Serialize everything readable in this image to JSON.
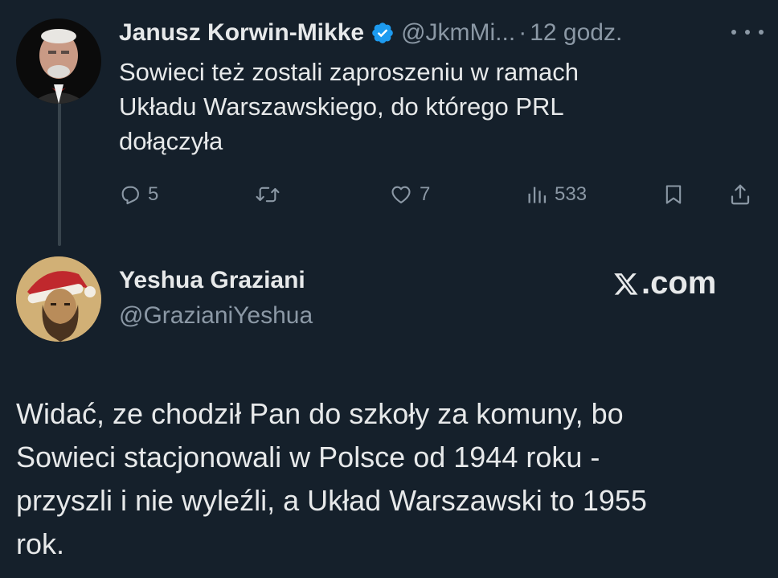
{
  "tweet1": {
    "author_name": "Janusz Korwin-Mikke",
    "handle": "@JkmMi...",
    "separator": "·",
    "time": "12 godz.",
    "text": "Sowieci też zostali zaproszeniu w ramach\nUkładu Warszawskiego, do którego PRL\ndołączyła",
    "actions": {
      "replies": "5",
      "reposts": "",
      "likes": "7",
      "views": "533"
    },
    "icons": [
      "verified-badge-icon",
      "more-icon",
      "reply-icon",
      "retweet-icon",
      "like-icon",
      "views-icon",
      "bookmark-icon",
      "share-icon"
    ]
  },
  "tweet2": {
    "author_name": "Yeshua Graziani",
    "handle": "@GrazianiYeshua",
    "text": "Widać, ze chodził Pan do szkoły za komuny, bo\nSowieci stacjonowali w Polsce od 1944 roku -\nprzyszli i nie wyleźli, a Układ Warszawski to 1955\nrok."
  },
  "watermark": {
    "text": ".com"
  },
  "colors": {
    "background": "#15202b",
    "text_primary": "#e7e9ea",
    "text_secondary": "#8b98a5",
    "verified": "#1d9bf0",
    "thread_line": "#38444d"
  }
}
